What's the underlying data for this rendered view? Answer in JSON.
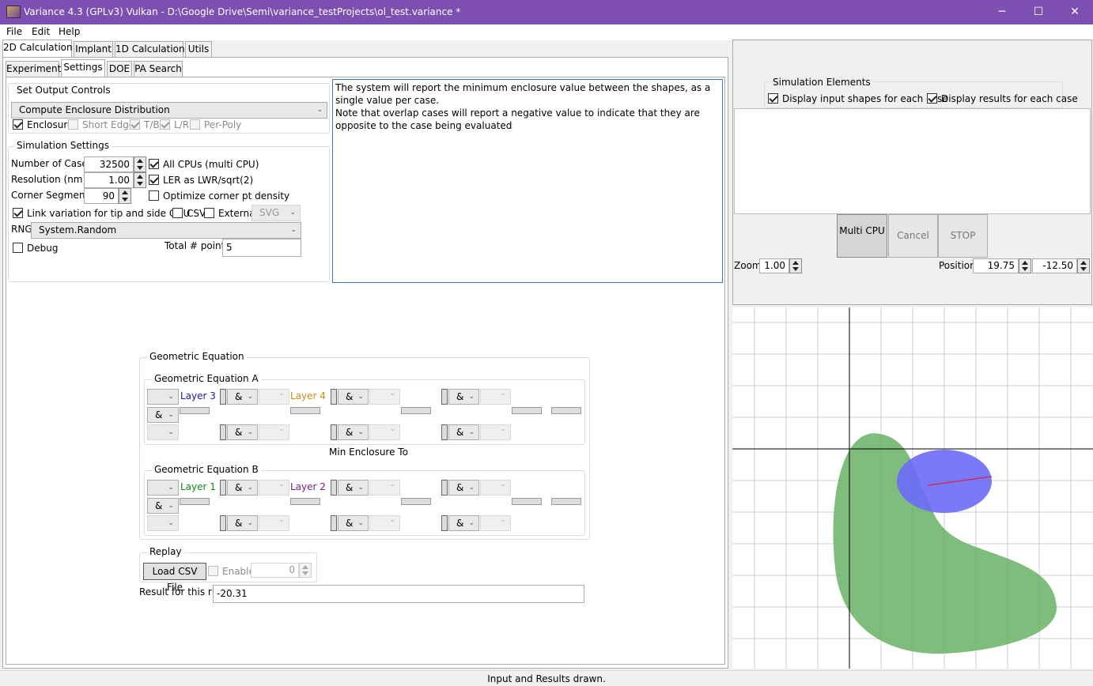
{
  "window": {
    "title": "Variance 4.3 (GPLv3) Vulkan - D:\\Google Drive\\Semi\\variance_testProjects\\ol_test.variance *",
    "minimize": "─",
    "maximize": "☐",
    "close": "✕"
  },
  "menu": [
    "File",
    "Edit",
    "Help"
  ],
  "main_tabs": [
    "2D Calculation",
    "Implant",
    "1D Calculation",
    "Utils"
  ],
  "sub_tabs": [
    "Experiment",
    "Settings",
    "DOE",
    "PA Search"
  ],
  "output_controls": {
    "title": "Set Output Controls",
    "mode": "Compute Enclosure Distribution",
    "checks": [
      {
        "label": "Enclosure",
        "checked": true,
        "enabled": true
      },
      {
        "label": "Short Edge",
        "checked": false,
        "enabled": false
      },
      {
        "label": "T/B",
        "checked": true,
        "enabled": false
      },
      {
        "label": "L/R",
        "checked": true,
        "enabled": false
      },
      {
        "label": "Per-Poly",
        "checked": false,
        "enabled": false
      }
    ]
  },
  "description": [
    "The system will report the minimum enclosure value between the shapes, as a single value per case.",
    "Note that overlap cases will report a negative value to indicate that they are opposite to the case being evaluated"
  ],
  "sim_settings": {
    "title": "Simulation Settings",
    "num_cases_label": "Number of Cases",
    "num_cases": "32500",
    "resolution_label": "Resolution (nm)",
    "resolution": "1.00",
    "corner_label": "Corner Segments",
    "corner": "90",
    "all_cpus": "All CPUs (multi CPU)",
    "ler": "LER as LWR/sqrt(2)",
    "optimize": "Optimize corner pt density",
    "link": "Link variation for tip and side CDU",
    "csv": "CSV",
    "external": "External",
    "ext_format": "SVG",
    "rng_label": "RNG",
    "rng": "System.Random",
    "debug": "Debug",
    "total_points_label": "Total # points",
    "total_points": "5"
  },
  "geo": {
    "title": "Geometric Equation",
    "a_title": "Geometric Equation A",
    "b_title": "Geometric Equation B",
    "layer3": "Layer 3",
    "layer4": "Layer 4",
    "layer1": "Layer 1",
    "layer2": "Layer 2",
    "amp": "&",
    "min_label": "Min Enclosure To",
    "colors": {
      "layer3": "#1a1aa8",
      "layer4": "#d08a10",
      "layer1": "#138a13",
      "layer2": "#7a1a8a"
    }
  },
  "replay": {
    "title": "Replay",
    "load": "Load CSV File",
    "enable": "Enable",
    "value": "0"
  },
  "result": {
    "label": "Result for this run",
    "value": "-20.31"
  },
  "sim_elements": {
    "title": "Simulation Elements",
    "show_input": "Display input shapes for each case",
    "show_results": "Display results for each case"
  },
  "controls": {
    "multi_cpu": "Multi CPU",
    "cancel": "Cancel",
    "stop": "STOP",
    "zoom_label": "Zoom",
    "zoom": "1.00",
    "position_label": "Position",
    "pos_x": "19.75",
    "pos_y": "-12.50"
  },
  "viewport": {
    "green": "#5fac5b",
    "blue": "#6a6af8",
    "red": "#e0203c"
  },
  "status": "Input and Results drawn."
}
